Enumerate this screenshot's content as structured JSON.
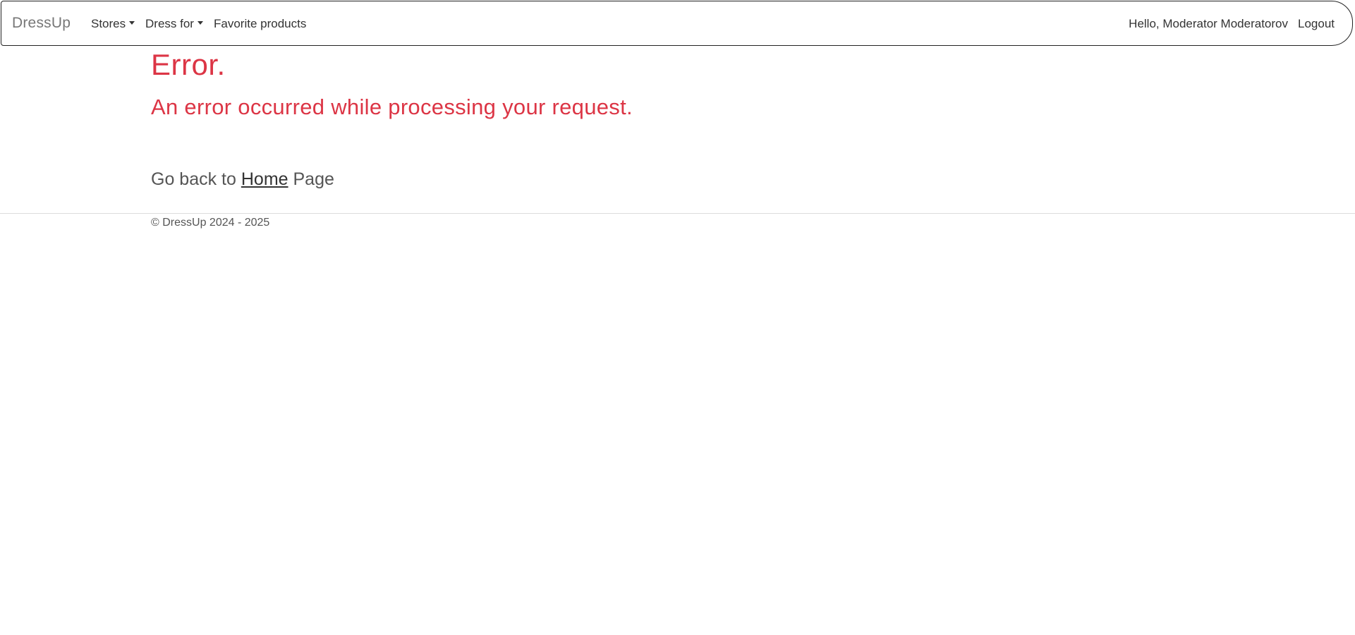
{
  "navbar": {
    "brand": "DressUp",
    "items": [
      {
        "label": "Stores",
        "dropdown": true
      },
      {
        "label": "Dress for",
        "dropdown": true
      },
      {
        "label": "Favorite products",
        "dropdown": false
      }
    ],
    "greeting": "Hello, Moderator Moderatorov",
    "logout": "Logout"
  },
  "main": {
    "title": "Error.",
    "subtitle": "An error occurred while processing your request.",
    "go_back_prefix": "Go back to ",
    "go_back_link": "Home",
    "go_back_suffix": " Page"
  },
  "footer": {
    "text": "© DressUp 2024 - 2025"
  },
  "colors": {
    "error": "#dc3545",
    "text": "#444444",
    "brand": "#777777"
  }
}
